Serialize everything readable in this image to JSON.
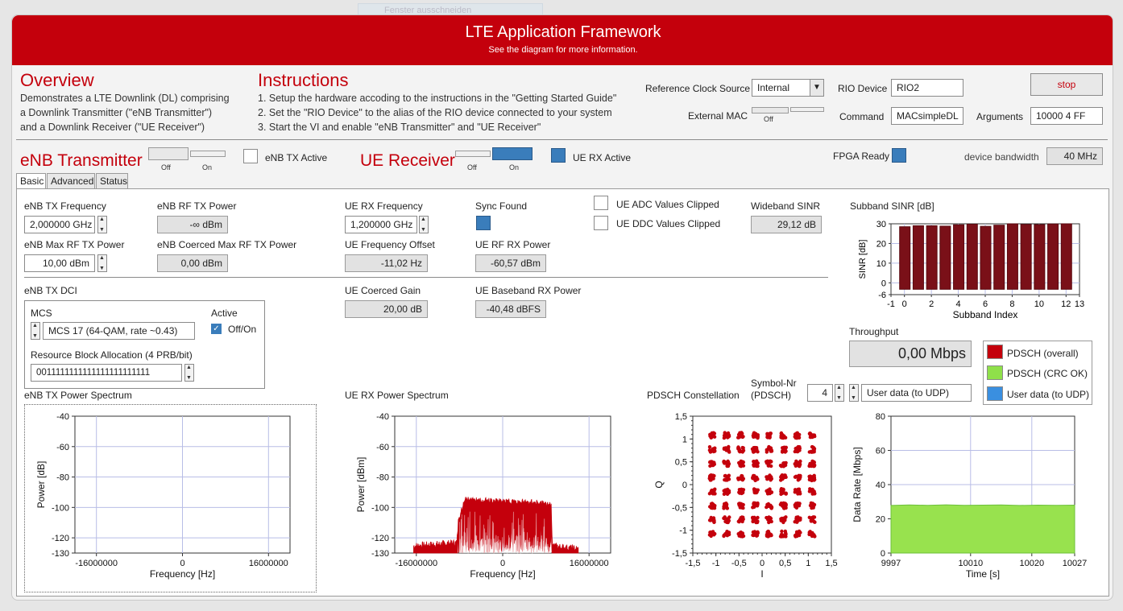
{
  "ghost": {
    "label": "Fenster ausschneiden"
  },
  "header": {
    "title": "LTE Application Framework",
    "subtitle": "See the diagram for more information."
  },
  "overview": {
    "title": "Overview",
    "lines": [
      "Demonstrates a LTE Downlink (DL) comprising",
      "a Downlink Transmitter (\"eNB Transmitter\")",
      "and a Downlink Receiver (\"UE Receiver\")"
    ]
  },
  "instructions": {
    "title": "Instructions",
    "lines": [
      "1. Setup the hardware accoding to the instructions in the \"Getting Started Guide\"",
      "2. Set the \"RIO Device\" to the alias of the RIO device connected to your system",
      "3. Start the VI and enable \"eNB Transmitter\" and \"UE Receiver\""
    ]
  },
  "config": {
    "ref_clock_label": "Reference Clock Source",
    "ref_clock_value": "Internal",
    "ext_mac_label": "External MAC",
    "ext_mac_state": "Off",
    "rio_label": "RIO Device",
    "rio_value": "RIO2",
    "command_label": "Command",
    "command_value": "MACsimpleDL",
    "args_label": "Arguments",
    "args_value": "10000 4 FF",
    "stop_label": "stop"
  },
  "enb": {
    "title": "eNB Transmitter",
    "off": "Off",
    "on": "On",
    "active_label": "eNB TX Active",
    "enabled": false
  },
  "ue": {
    "title": "UE Receiver",
    "off": "Off",
    "on": "On",
    "active_label": "UE RX Active",
    "enabled": true
  },
  "fpga": {
    "ready_label": "FPGA Ready",
    "bw_label": "device bandwidth",
    "bw_value": "40 MHz"
  },
  "tabs": [
    "Basic",
    "Advanced",
    "Status"
  ],
  "basic": {
    "enb_tx_freq_label": "eNB TX Frequency",
    "enb_tx_freq": "2,000000 GHz",
    "enb_rf_tx_power_label": "eNB RF TX Power",
    "enb_rf_tx_power": "-∞ dBm",
    "enb_max_rf_label": "eNB Max RF TX Power",
    "enb_max_rf": "10,00 dBm",
    "enb_coerced_label": "eNB Coerced Max RF TX Power",
    "enb_coerced": "0,00 dBm",
    "ue_rx_freq_label": "UE RX Frequency",
    "ue_rx_freq": "1,200000 GHz",
    "sync_label": "Sync Found",
    "ue_freq_off_label": "UE Frequency Offset",
    "ue_freq_off": "-11,02 Hz",
    "ue_rf_rx_label": "UE RF RX Power",
    "ue_rf_rx": "-60,57 dBm",
    "adc_clip_label": "UE ADC Values Clipped",
    "ddc_clip_label": "UE DDC Values Clipped",
    "wb_sinr_label": "Wideband SINR",
    "wb_sinr": "29,12 dB",
    "dci_label": "eNB TX DCI",
    "mcs_label": "MCS",
    "mcs_value": "MCS 17 (64-QAM, rate ~0.43)",
    "active_label": "Active",
    "active_state": "Off/On",
    "rb_label": "Resource Block Allocation (4 PRB/bit)",
    "rb_value": "0011111111111111111111111",
    "ue_gain_label": "UE Coerced Gain",
    "ue_gain": "20,00 dB",
    "ue_bb_label": "UE Baseband RX Power",
    "ue_bb": "-40,48 dBFS",
    "subband_label": "Subband SINR [dB]",
    "throughput_label": "Throughput",
    "throughput": "0,00 Mbps",
    "symbol_label_1": "Symbol-Nr",
    "symbol_label_2": "(PDSCH)",
    "symbol_value": "4",
    "user_data": "User data (to UDP)",
    "legend": [
      "PDSCH (overall)",
      "PDSCH (CRC OK)",
      "User data (to UDP)"
    ],
    "legend_colors": [
      "#c4000c",
      "#8fe04a",
      "#3a8fe0"
    ],
    "enb_spec_label": "eNB TX Power Spectrum",
    "ue_spec_label": "UE RX Power Spectrum",
    "const_label": "PDSCH Constellation"
  },
  "chart_data": [
    {
      "type": "bar",
      "title": "Subband SINR [dB]",
      "xlabel": "Subband Index",
      "ylabel": "SINR [dB]",
      "categories": [
        0,
        1,
        2,
        3,
        4,
        5,
        6,
        7,
        8,
        9,
        10,
        11,
        12
      ],
      "values": [
        28.5,
        29,
        29,
        28.8,
        29.5,
        29.8,
        28.7,
        29.3,
        30,
        29.7,
        29.6,
        29.9,
        30
      ],
      "xlim": [
        -1,
        13
      ],
      "ylim": [
        -6,
        30
      ],
      "xticks": [
        "-1",
        "0",
        "2",
        "4",
        "6",
        "8",
        "10",
        "12",
        "13"
      ],
      "yticks": [
        "30",
        "20",
        "10",
        "0",
        "-6"
      ],
      "color": "#7a1018"
    },
    {
      "type": "line",
      "title": "eNB TX Power Spectrum",
      "xlabel": "Frequency [Hz]",
      "ylabel": "Power [dB]",
      "x": [],
      "y": [],
      "xlim": [
        -20000000,
        20000000
      ],
      "ylim": [
        -130,
        -40
      ],
      "xticks": [
        "-16000000",
        "0",
        "16000000"
      ],
      "yticks": [
        "-40",
        "-60",
        "-80",
        "-100",
        "-120",
        "-130"
      ]
    },
    {
      "type": "area",
      "title": "UE RX Power Spectrum",
      "xlabel": "Frequency [Hz]",
      "ylabel": "Power [dBm]",
      "x": [
        -16500000,
        -9000000,
        -8500000,
        -8200000,
        -7000000,
        0,
        7000000,
        9000000,
        9200000,
        14000000
      ],
      "y": [
        -128,
        -126,
        -126,
        -108,
        -95,
        -96,
        -97,
        -99,
        -128,
        -130
      ],
      "xlim": [
        -20000000,
        20000000
      ],
      "ylim": [
        -130,
        -40
      ],
      "xticks": [
        "-16000000",
        "0",
        "16000000"
      ],
      "yticks": [
        "-40",
        "-60",
        "-80",
        "-100",
        "-120",
        "-130"
      ],
      "color": "#c4000c"
    },
    {
      "type": "scatter",
      "title": "PDSCH Constellation",
      "xlabel": "I",
      "ylabel": "Q",
      "x_levels": [
        -1.08,
        -0.77,
        -0.46,
        -0.15,
        0.15,
        0.46,
        0.77,
        1.08
      ],
      "y_levels": [
        -1.08,
        -0.77,
        -0.46,
        -0.15,
        0.15,
        0.46,
        0.77,
        1.08
      ],
      "xlim": [
        -1.5,
        1.5
      ],
      "ylim": [
        -1.5,
        1.5
      ],
      "xticks": [
        "-1,5",
        "-1",
        "-0,5",
        "0",
        "0,5",
        "1",
        "1,5"
      ],
      "yticks": [
        "1,5",
        "1",
        "0,5",
        "0",
        "-0,5",
        "-1",
        "-1,5"
      ],
      "color": "#c4000c"
    },
    {
      "type": "area",
      "title": "Throughput",
      "xlabel": "Time [s]",
      "ylabel": "Data Rate [Mbps]",
      "x": [
        9997,
        10000,
        10003,
        10006,
        10009,
        10012,
        10015,
        10018,
        10021,
        10024,
        10027
      ],
      "y": [
        27.8,
        28.1,
        27.9,
        28.2,
        27.9,
        28,
        28.1,
        27.8,
        28,
        27.9,
        28
      ],
      "xlim": [
        9997,
        10027
      ],
      "ylim": [
        0,
        80
      ],
      "xticks": [
        "9997",
        "10010",
        "10020",
        "10027"
      ],
      "yticks": [
        "80",
        "60",
        "40",
        "20",
        "0"
      ],
      "color": "#98e24e"
    }
  ]
}
